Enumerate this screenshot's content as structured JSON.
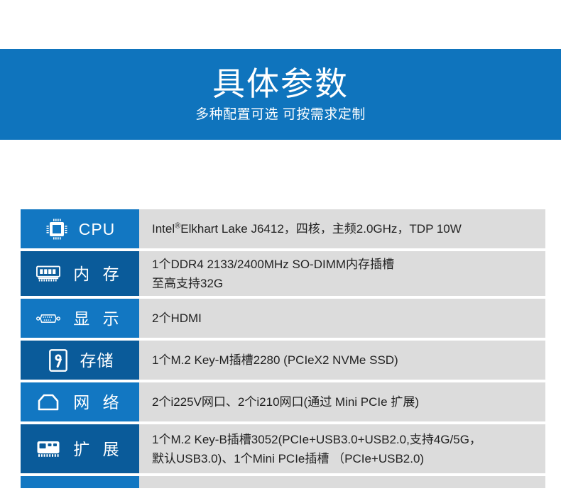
{
  "banner": {
    "title": "具体参数",
    "subtitle": "多种配置可选 可按需求定制",
    "background_color": "#0f74bd",
    "text_color": "#ffffff"
  },
  "colors": {
    "label_light_blue": "#1277c2",
    "label_dark_blue": "#0a5b9a",
    "value_background": "#dcdcdc",
    "value_text": "#222222",
    "page_background": "#ffffff"
  },
  "spec_table": {
    "rows": [
      {
        "icon": "cpu-chip-icon",
        "label": "CPU",
        "label_style": "light",
        "lines": [
          "Intel®Elkhart Lake J6412，四核，主频2.0GHz，TDP 10W"
        ]
      },
      {
        "icon": "memory-ram-icon",
        "label": "内 存",
        "label_style": "dark",
        "lines": [
          "1个DDR4 2133/2400MHz SO-DIMM内存插槽",
          "至高支持32G"
        ]
      },
      {
        "icon": "vga-connector-icon",
        "label": "显 示",
        "label_style": "light",
        "lines": [
          "2个HDMI"
        ]
      },
      {
        "icon": "hard-disk-icon",
        "label": "存储",
        "label_style": "dark",
        "lines": [
          "1个M.2 Key-M插槽2280 (PCIeX2 NVMe SSD)"
        ]
      },
      {
        "icon": "rj45-network-icon",
        "label": "网 络",
        "label_style": "light",
        "lines": [
          "2个i225V网口、2个i210网口(通过 Mini PCIe 扩展)"
        ]
      },
      {
        "icon": "expansion-card-icon",
        "label": "扩 展",
        "label_style": "dark",
        "lines": [
          "1个M.2 Key-B插槽3052(PCIe+USB3.0+USB2.0,支持4G/5G，",
          "默认USB3.0)、1个Mini PCIe插槽 （PCIe+USB2.0)"
        ]
      },
      {
        "icon": "",
        "label": "",
        "label_style": "light",
        "lines": [
          ""
        ]
      }
    ]
  }
}
